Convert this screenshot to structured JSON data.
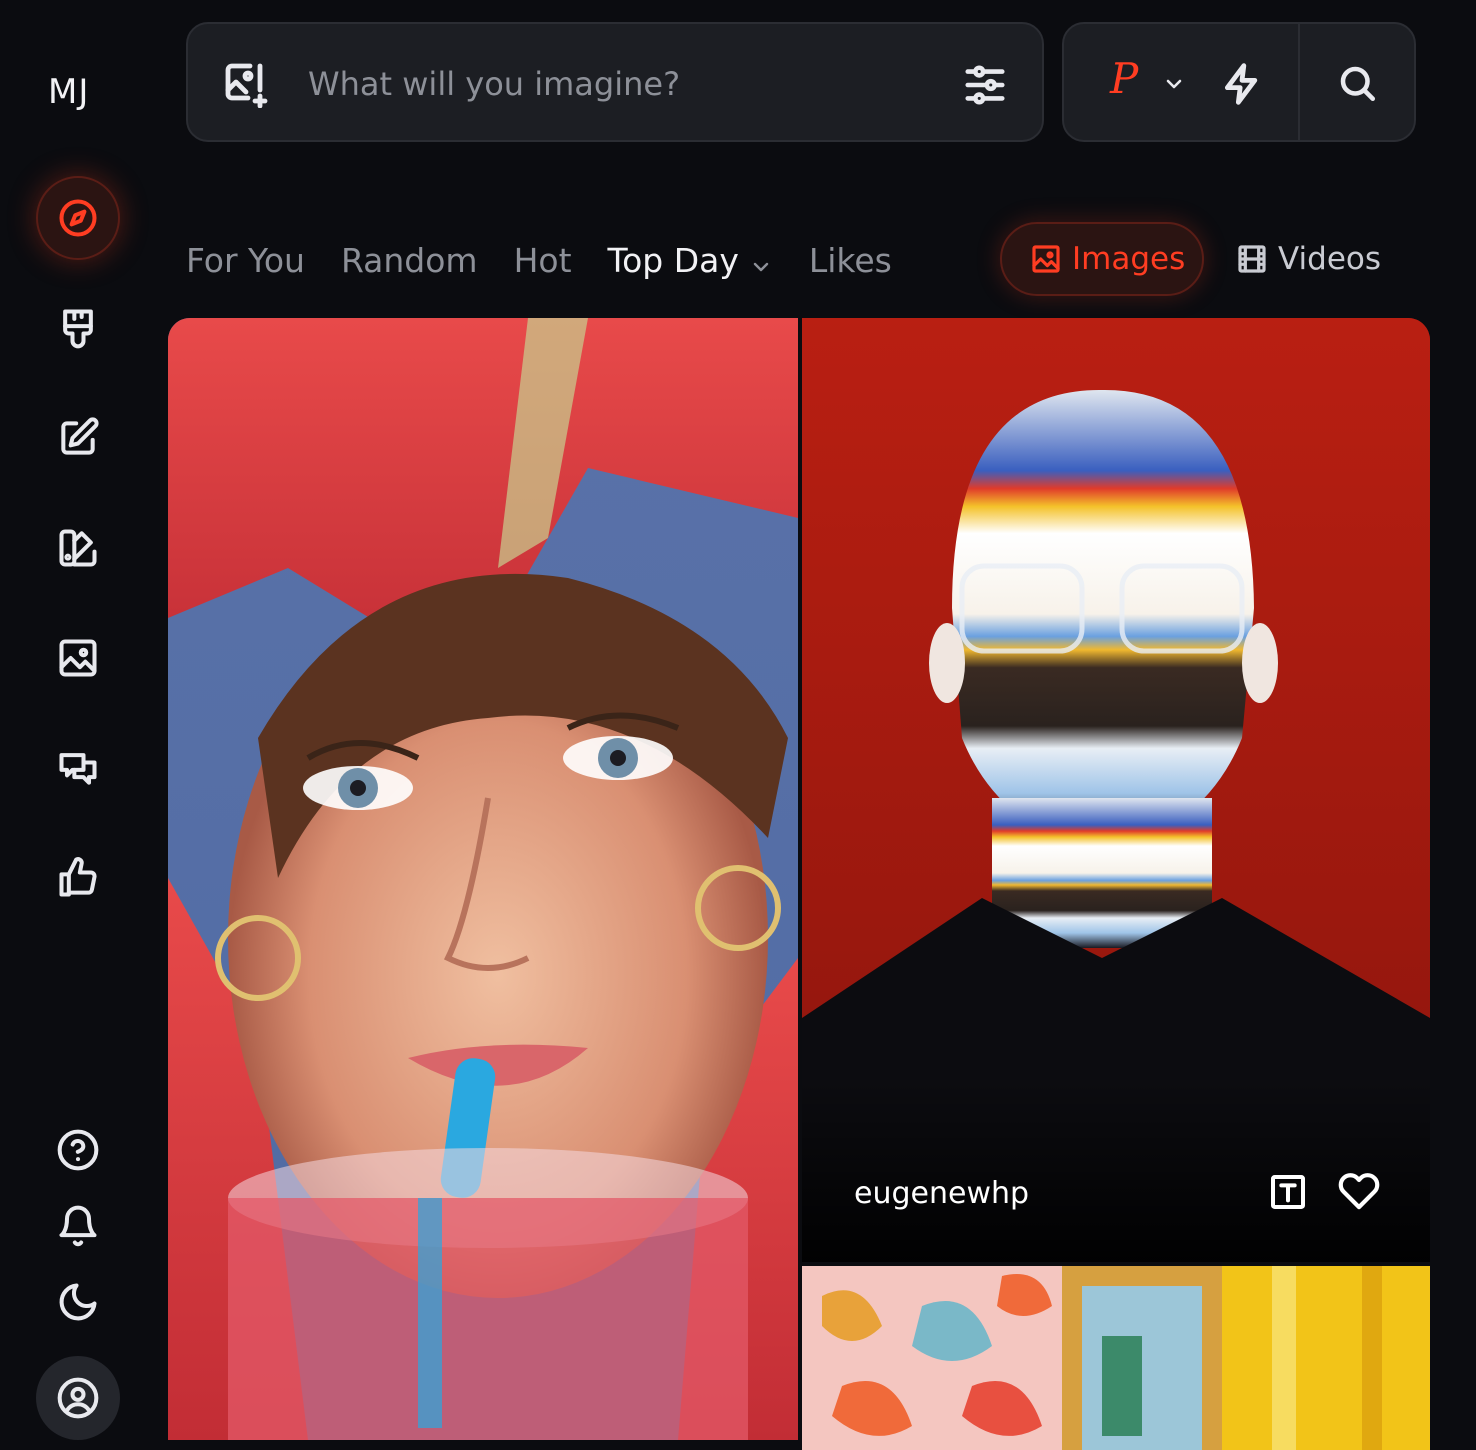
{
  "app": {
    "logo": "MJ"
  },
  "sidebar": {
    "items": [
      {
        "name": "explore",
        "icon": "compass-icon",
        "active": true
      },
      {
        "name": "create",
        "icon": "paintbrush-icon"
      },
      {
        "name": "edit",
        "icon": "edit-icon"
      },
      {
        "name": "personalize",
        "icon": "palette-icon"
      },
      {
        "name": "organize",
        "icon": "image-icon"
      },
      {
        "name": "chat",
        "icon": "chat-icon"
      },
      {
        "name": "tasks",
        "icon": "thumbs-up-icon"
      }
    ],
    "bottom": [
      {
        "name": "help",
        "icon": "help-icon"
      },
      {
        "name": "notifications",
        "icon": "bell-icon"
      },
      {
        "name": "theme",
        "icon": "moon-icon"
      },
      {
        "name": "profile",
        "icon": "profile-icon"
      }
    ]
  },
  "search": {
    "placeholder": "What will you imagine?",
    "value": "",
    "mode_label": "P"
  },
  "tabs": [
    {
      "label": "For You",
      "active": false
    },
    {
      "label": "Random",
      "active": false
    },
    {
      "label": "Hot",
      "active": false
    },
    {
      "label": "Top Day",
      "active": true,
      "dropdown": true
    },
    {
      "label": "Likes",
      "active": false
    }
  ],
  "media_type": {
    "images_label": "Images",
    "videos_label": "Videos",
    "selected": "Images"
  },
  "gallery": [
    {
      "id": "card-1",
      "description_icon": "portrait-image"
    },
    {
      "id": "card-2",
      "author": "eugenewhp"
    },
    {
      "id": "card-3"
    }
  ],
  "colors": {
    "accent": "#ff3d22",
    "background": "#0b0c10",
    "surface": "#1c1e23"
  }
}
